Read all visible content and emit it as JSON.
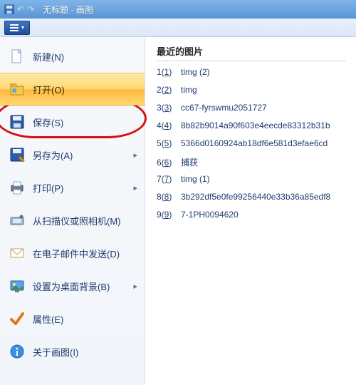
{
  "titlebar": {
    "title": "无标题 - 画图"
  },
  "menu": {
    "items": [
      {
        "label": "新建(N)",
        "arrow": false,
        "highlight": false,
        "name": "menu-item-new",
        "icon": "new-doc-icon"
      },
      {
        "label": "打开(O)",
        "arrow": false,
        "highlight": true,
        "name": "menu-item-open",
        "icon": "open-folder-icon"
      },
      {
        "label": "保存(S)",
        "arrow": false,
        "highlight": false,
        "name": "menu-item-save",
        "icon": "save-icon"
      },
      {
        "label": "另存为(A)",
        "arrow": true,
        "highlight": false,
        "name": "menu-item-save-as",
        "icon": "save-as-icon"
      },
      {
        "label": "打印(P)",
        "arrow": true,
        "highlight": false,
        "name": "menu-item-print",
        "icon": "print-icon"
      },
      {
        "label": "从扫描仪或照相机(M)",
        "arrow": false,
        "highlight": false,
        "name": "menu-item-scanner",
        "icon": "scanner-icon"
      },
      {
        "label": "在电子邮件中发送(D)",
        "arrow": false,
        "highlight": false,
        "name": "menu-item-email",
        "icon": "email-icon"
      },
      {
        "label": "设置为桌面背景(B)",
        "arrow": true,
        "highlight": false,
        "name": "menu-item-wallpaper",
        "icon": "wallpaper-icon"
      },
      {
        "label": "属性(E)",
        "arrow": false,
        "highlight": false,
        "name": "menu-item-properties",
        "icon": "checkmark-icon"
      },
      {
        "label": "关于画图(I)",
        "arrow": false,
        "highlight": false,
        "name": "menu-item-about",
        "icon": "info-icon"
      }
    ]
  },
  "recent": {
    "title": "最近的图片",
    "items": [
      {
        "hotkey": "1",
        "name": "timg (2)"
      },
      {
        "hotkey": "2",
        "name": "timg"
      },
      {
        "hotkey": "3",
        "name": "cc67-fyrswmu2051727"
      },
      {
        "hotkey": "4",
        "name": "8b82b9014a90f603e4eecde83312b31b"
      },
      {
        "hotkey": "5",
        "name": "5366d0160924ab18df6e581d3efae6cd"
      },
      {
        "hotkey": "6",
        "name": "捕获"
      },
      {
        "hotkey": "7",
        "name": "timg (1)"
      },
      {
        "hotkey": "8",
        "name": "3b292df5e0fe99256440e33b36a85edf8"
      },
      {
        "hotkey": "9",
        "name": "7-1PH0094620"
      }
    ]
  }
}
